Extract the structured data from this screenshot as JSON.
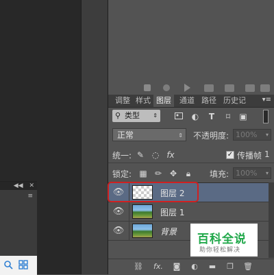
{
  "mini_panel": {
    "header_arrows": "◀◀",
    "header_close": "✕",
    "menu_icon": "≡",
    "toolbar_icons": [
      "search-icon",
      "grid-icon"
    ]
  },
  "top_icons": [
    "play-first-icon",
    "stop-icon",
    "play-icon",
    "folder-icon",
    "new-layer-icon",
    "trash-icon"
  ],
  "tabs": [
    "调整",
    "样式",
    "图层",
    "通道",
    "路径",
    "历史记"
  ],
  "active_tab": "图层",
  "tabs_menu": "▾≡",
  "filter": {
    "kind_label": "类型",
    "icons": [
      "image-filter-icon",
      "adjustment-filter-icon",
      "text-filter-icon",
      "shape-filter-icon",
      "smart-object-filter-icon"
    ]
  },
  "blend": {
    "mode": "正常",
    "opacity_label": "不透明度:",
    "opacity_value": "100%"
  },
  "unify": {
    "label": "统一:",
    "propagate_label": "传播帧",
    "propagate_value": "1",
    "propagate_checked": true
  },
  "lock": {
    "label": "锁定:",
    "fill_label": "填充:",
    "fill_value": "100%"
  },
  "layers": [
    {
      "name": "图层 2",
      "thumb": "transparent",
      "selected": true,
      "visible": true
    },
    {
      "name": "图层 1",
      "thumb": "image",
      "selected": false,
      "visible": true
    },
    {
      "name": "背景",
      "thumb": "image",
      "selected": false,
      "visible": true
    }
  ],
  "bottom_bar": {
    "fx_label": "fx.",
    "icons": [
      "link-icon",
      "fx-icon",
      "mask-icon",
      "adjustment-icon",
      "group-icon",
      "new-layer-icon",
      "trash-icon"
    ]
  },
  "watermark": {
    "title": "百科全说",
    "subtitle": "助你轻松解决"
  },
  "colors": {
    "selected_layer": "#5a6a84",
    "highlight_border": "#d02020",
    "watermark_green": "#20a84a"
  }
}
